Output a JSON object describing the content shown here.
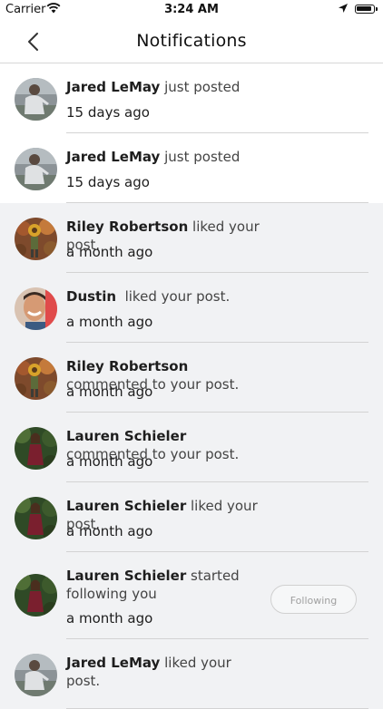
{
  "status_bar": {
    "carrier": "Carrier",
    "time": "3:24 AM"
  },
  "header": {
    "title": "Notifications"
  },
  "colors": {
    "new_background": "#ffffff",
    "old_background": "#f1f2f4",
    "separator": "#d3d3d3"
  },
  "notifications": [
    {
      "name": "Jared LeMay",
      "action": " just posted",
      "time": "15 days ago",
      "avatar": "jared",
      "unread": true
    },
    {
      "name": "Jared LeMay",
      "action": " just posted",
      "time": "15 days ago",
      "avatar": "jared",
      "unread": true
    },
    {
      "name": "Riley Robertson",
      "action": " liked your post.",
      "time": "a month ago",
      "avatar": "riley",
      "unread": false
    },
    {
      "name": "Dustin",
      "action": "  liked your post.",
      "time": "a month ago",
      "avatar": "dustin",
      "unread": false
    },
    {
      "name": "Riley Robertson",
      "action": " commented to your post.",
      "time": "a month ago",
      "avatar": "riley",
      "unread": false
    },
    {
      "name": "Lauren Schieler",
      "action": " commented to your post.",
      "time": "a month ago",
      "avatar": "lauren",
      "unread": false
    },
    {
      "name": "Lauren Schieler",
      "action": " liked your post.",
      "time": "a month ago",
      "avatar": "lauren",
      "unread": false
    },
    {
      "name": "Lauren Schieler",
      "action": " started following you",
      "time": "a month ago",
      "avatar": "lauren",
      "unread": false,
      "button": "Following"
    },
    {
      "name": "Jared LeMay",
      "action": " liked your post.",
      "time": "",
      "avatar": "jared",
      "unread": false
    }
  ]
}
